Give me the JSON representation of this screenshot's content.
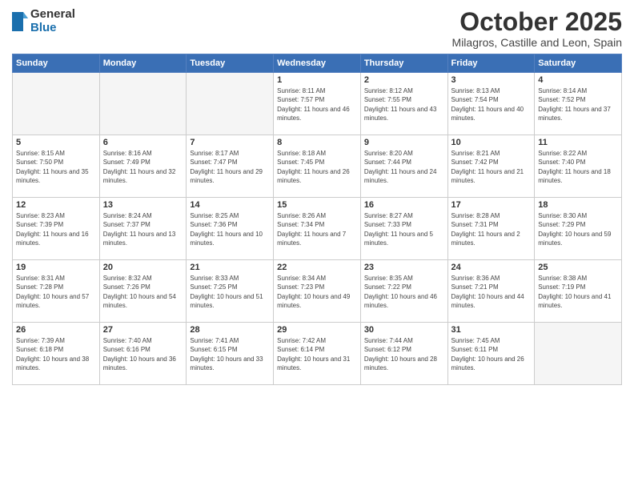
{
  "logo": {
    "line1": "General",
    "line2": "Blue"
  },
  "header": {
    "month": "October 2025",
    "location": "Milagros, Castille and Leon, Spain"
  },
  "weekdays": [
    "Sunday",
    "Monday",
    "Tuesday",
    "Wednesday",
    "Thursday",
    "Friday",
    "Saturday"
  ],
  "weeks": [
    [
      {
        "day": "",
        "info": ""
      },
      {
        "day": "",
        "info": ""
      },
      {
        "day": "",
        "info": ""
      },
      {
        "day": "1",
        "info": "Sunrise: 8:11 AM\nSunset: 7:57 PM\nDaylight: 11 hours and 46 minutes."
      },
      {
        "day": "2",
        "info": "Sunrise: 8:12 AM\nSunset: 7:55 PM\nDaylight: 11 hours and 43 minutes."
      },
      {
        "day": "3",
        "info": "Sunrise: 8:13 AM\nSunset: 7:54 PM\nDaylight: 11 hours and 40 minutes."
      },
      {
        "day": "4",
        "info": "Sunrise: 8:14 AM\nSunset: 7:52 PM\nDaylight: 11 hours and 37 minutes."
      }
    ],
    [
      {
        "day": "5",
        "info": "Sunrise: 8:15 AM\nSunset: 7:50 PM\nDaylight: 11 hours and 35 minutes."
      },
      {
        "day": "6",
        "info": "Sunrise: 8:16 AM\nSunset: 7:49 PM\nDaylight: 11 hours and 32 minutes."
      },
      {
        "day": "7",
        "info": "Sunrise: 8:17 AM\nSunset: 7:47 PM\nDaylight: 11 hours and 29 minutes."
      },
      {
        "day": "8",
        "info": "Sunrise: 8:18 AM\nSunset: 7:45 PM\nDaylight: 11 hours and 26 minutes."
      },
      {
        "day": "9",
        "info": "Sunrise: 8:20 AM\nSunset: 7:44 PM\nDaylight: 11 hours and 24 minutes."
      },
      {
        "day": "10",
        "info": "Sunrise: 8:21 AM\nSunset: 7:42 PM\nDaylight: 11 hours and 21 minutes."
      },
      {
        "day": "11",
        "info": "Sunrise: 8:22 AM\nSunset: 7:40 PM\nDaylight: 11 hours and 18 minutes."
      }
    ],
    [
      {
        "day": "12",
        "info": "Sunrise: 8:23 AM\nSunset: 7:39 PM\nDaylight: 11 hours and 16 minutes."
      },
      {
        "day": "13",
        "info": "Sunrise: 8:24 AM\nSunset: 7:37 PM\nDaylight: 11 hours and 13 minutes."
      },
      {
        "day": "14",
        "info": "Sunrise: 8:25 AM\nSunset: 7:36 PM\nDaylight: 11 hours and 10 minutes."
      },
      {
        "day": "15",
        "info": "Sunrise: 8:26 AM\nSunset: 7:34 PM\nDaylight: 11 hours and 7 minutes."
      },
      {
        "day": "16",
        "info": "Sunrise: 8:27 AM\nSunset: 7:33 PM\nDaylight: 11 hours and 5 minutes."
      },
      {
        "day": "17",
        "info": "Sunrise: 8:28 AM\nSunset: 7:31 PM\nDaylight: 11 hours and 2 minutes."
      },
      {
        "day": "18",
        "info": "Sunrise: 8:30 AM\nSunset: 7:29 PM\nDaylight: 10 hours and 59 minutes."
      }
    ],
    [
      {
        "day": "19",
        "info": "Sunrise: 8:31 AM\nSunset: 7:28 PM\nDaylight: 10 hours and 57 minutes."
      },
      {
        "day": "20",
        "info": "Sunrise: 8:32 AM\nSunset: 7:26 PM\nDaylight: 10 hours and 54 minutes."
      },
      {
        "day": "21",
        "info": "Sunrise: 8:33 AM\nSunset: 7:25 PM\nDaylight: 10 hours and 51 minutes."
      },
      {
        "day": "22",
        "info": "Sunrise: 8:34 AM\nSunset: 7:23 PM\nDaylight: 10 hours and 49 minutes."
      },
      {
        "day": "23",
        "info": "Sunrise: 8:35 AM\nSunset: 7:22 PM\nDaylight: 10 hours and 46 minutes."
      },
      {
        "day": "24",
        "info": "Sunrise: 8:36 AM\nSunset: 7:21 PM\nDaylight: 10 hours and 44 minutes."
      },
      {
        "day": "25",
        "info": "Sunrise: 8:38 AM\nSunset: 7:19 PM\nDaylight: 10 hours and 41 minutes."
      }
    ],
    [
      {
        "day": "26",
        "info": "Sunrise: 7:39 AM\nSunset: 6:18 PM\nDaylight: 10 hours and 38 minutes."
      },
      {
        "day": "27",
        "info": "Sunrise: 7:40 AM\nSunset: 6:16 PM\nDaylight: 10 hours and 36 minutes."
      },
      {
        "day": "28",
        "info": "Sunrise: 7:41 AM\nSunset: 6:15 PM\nDaylight: 10 hours and 33 minutes."
      },
      {
        "day": "29",
        "info": "Sunrise: 7:42 AM\nSunset: 6:14 PM\nDaylight: 10 hours and 31 minutes."
      },
      {
        "day": "30",
        "info": "Sunrise: 7:44 AM\nSunset: 6:12 PM\nDaylight: 10 hours and 28 minutes."
      },
      {
        "day": "31",
        "info": "Sunrise: 7:45 AM\nSunset: 6:11 PM\nDaylight: 10 hours and 26 minutes."
      },
      {
        "day": "",
        "info": ""
      }
    ]
  ]
}
